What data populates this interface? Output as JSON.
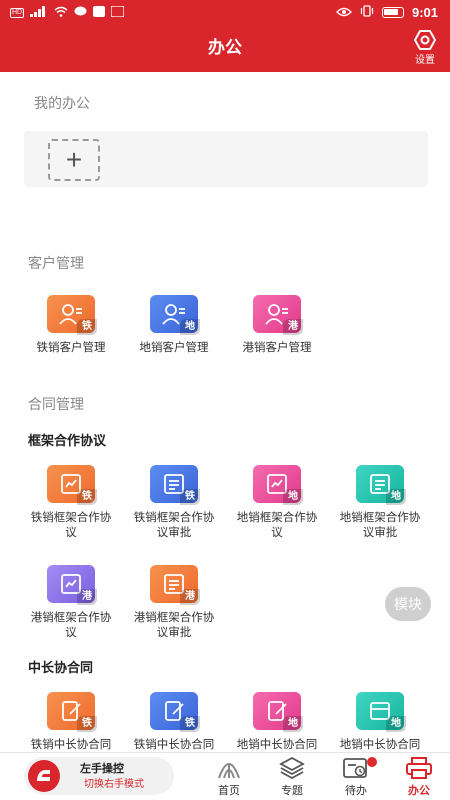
{
  "status_bar": {
    "time": "9:01"
  },
  "header": {
    "title": "办公",
    "settings_label": "设置"
  },
  "my_office": {
    "section_label": "我的办公",
    "add_symbol": "+"
  },
  "customer": {
    "section_label": "客户管理",
    "items": [
      {
        "label": "铁销客户管理",
        "badge": "铁",
        "color": "#ef6a2f"
      },
      {
        "label": "地销客户管理",
        "badge": "地",
        "color": "#3a63d8"
      },
      {
        "label": "港销客户管理",
        "badge": "港",
        "color": "#e23a8a"
      }
    ]
  },
  "contract": {
    "section_label": "合同管理",
    "framework": {
      "label": "框架合作协议",
      "items": [
        {
          "label_line1": "铁销框架合作协",
          "label_line2": "议",
          "badge": "铁"
        },
        {
          "label_line1": "铁销框架合作协",
          "label_line2": "议审批",
          "badge": "铁"
        },
        {
          "label_line1": "地销框架合作协",
          "label_line2": "议",
          "badge": "地"
        },
        {
          "label_line1": "地销框架合作协",
          "label_line2": "议审批",
          "badge": "地"
        },
        {
          "label_line1": "港销框架合作协",
          "label_line2": "议",
          "badge": "港"
        },
        {
          "label_line1": "港销框架合作协",
          "label_line2": "议审批",
          "badge": "港"
        }
      ]
    },
    "long_term": {
      "label": "中长协合同",
      "items": [
        {
          "label": "铁销中长协合同",
          "badge": "铁"
        },
        {
          "label": "铁销中长协合同",
          "badge": "铁"
        },
        {
          "label": "地销中长协合同",
          "badge": "地"
        },
        {
          "label": "地销中长协合同",
          "badge": "地"
        }
      ]
    }
  },
  "float_button": {
    "label": "模块"
  },
  "bottom_nav": {
    "left_hand": {
      "title": "左手操控",
      "subtitle": "切换右手模式"
    },
    "tabs": [
      {
        "label": "首页"
      },
      {
        "label": "专题"
      },
      {
        "label": "待办"
      },
      {
        "label": "办公"
      }
    ]
  }
}
